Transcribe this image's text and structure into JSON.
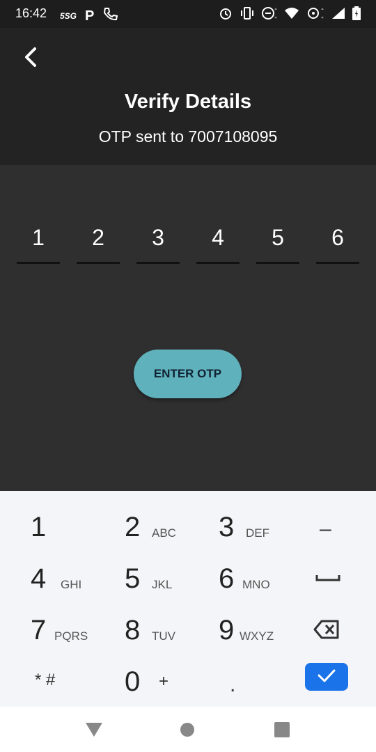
{
  "status_bar": {
    "time": "16:42",
    "left_icons": [
      "5sg-icon",
      "parking-p-icon",
      "phone-icon"
    ],
    "right_icons": [
      "alarm-icon",
      "vibrate-icon",
      "do-not-disturb-icon",
      "wifi-icon",
      "hotspot-icon",
      "signal-icon",
      "battery-icon"
    ],
    "network_label": "5SG",
    "p_label": "P"
  },
  "header": {
    "title": "Verify Details",
    "subtitle": "OTP sent to 7007108095"
  },
  "otp": {
    "digits": [
      "1",
      "2",
      "3",
      "4",
      "5",
      "6"
    ]
  },
  "enter_button": {
    "label": "ENTER OTP"
  },
  "keyboard": {
    "keys": [
      {
        "num": "1",
        "letters": ""
      },
      {
        "num": "2",
        "letters": "ABC"
      },
      {
        "num": "3",
        "letters": "DEF"
      },
      {
        "sym": "–"
      },
      {
        "num": "4",
        "letters": "GHI"
      },
      {
        "num": "5",
        "letters": "JKL"
      },
      {
        "num": "6",
        "letters": "MNO"
      },
      {
        "sym": "space"
      },
      {
        "num": "7",
        "letters": "PQRS"
      },
      {
        "num": "8",
        "letters": "TUV"
      },
      {
        "num": "9",
        "letters": "WXYZ"
      },
      {
        "sym": "backspace"
      },
      {
        "sym": "* #"
      },
      {
        "num": "0",
        "letters": "+"
      },
      {
        "sym": "."
      },
      {
        "sym": "done"
      }
    ]
  },
  "colors": {
    "header_bg": "#232323",
    "body_bg": "#2f2f30",
    "button_bg": "#5fb1bb",
    "keyboard_bg": "#f4f5f8",
    "done_bg": "#1a73e8"
  }
}
